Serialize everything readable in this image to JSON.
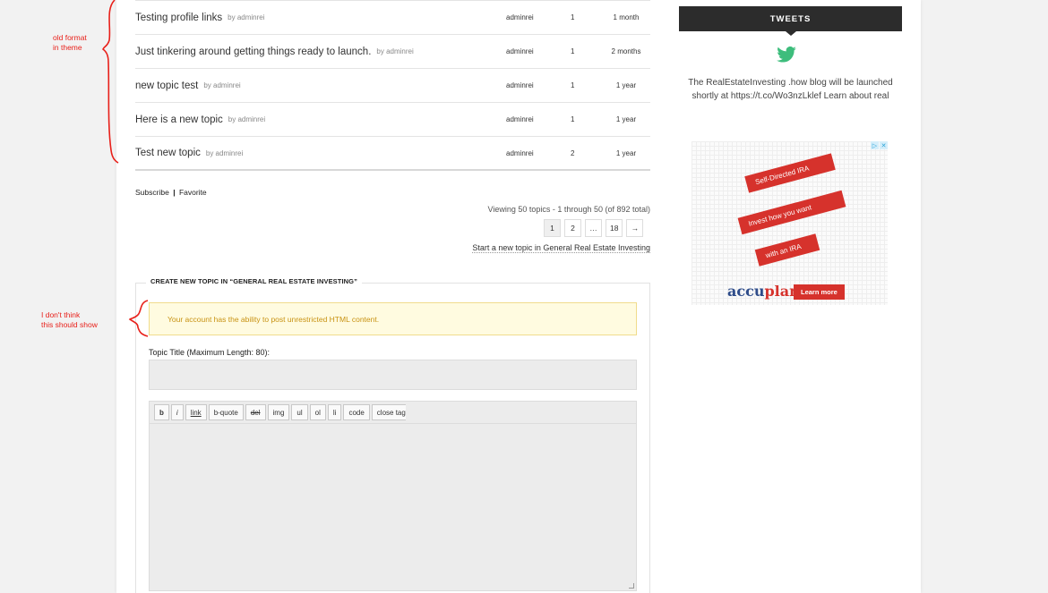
{
  "topics": [
    {
      "title": "Testing profile links",
      "by": "by adminrei",
      "author": "adminrei",
      "count": "1",
      "freshness": "1 month"
    },
    {
      "title": "Just tinkering around getting things ready to launch.",
      "by": "by adminrei",
      "author": "adminrei",
      "count": "1",
      "freshness": "2 months"
    },
    {
      "title": "new topic test",
      "by": "by adminrei",
      "author": "adminrei",
      "count": "1",
      "freshness": "1 year"
    },
    {
      "title": "Here is a new topic",
      "by": "by adminrei",
      "author": "adminrei",
      "count": "1",
      "freshness": "1 year"
    },
    {
      "title": "Test new topic",
      "by": "by adminrei",
      "author": "adminrei",
      "count": "2",
      "freshness": "1 year"
    }
  ],
  "forum_actions": {
    "subscribe": "Subscribe",
    "separator": "|",
    "favorite": "Favorite"
  },
  "pagination": {
    "viewing": "Viewing 50 topics - 1 through 50 (of 892 total)",
    "pages": [
      "1",
      "2",
      "…",
      "18",
      "→"
    ],
    "current": "1",
    "start_new": "Start a new topic in General Real Estate Investing"
  },
  "new_topic": {
    "legend": "CREATE NEW TOPIC IN “GENERAL REAL ESTATE INVESTING”",
    "notice": "Your account has the ability to post unrestricted HTML content.",
    "title_label": "Topic Title (Maximum Length: 80):",
    "title_value": "",
    "toolbar": [
      "b",
      "i",
      "link",
      "b-quote",
      "del",
      "img",
      "ul",
      "ol",
      "li",
      "code",
      "close tags"
    ]
  },
  "sidebar": {
    "tweets_heading": "TWEETS",
    "tweet": "The RealEstateInvesting .how blog will be launched shortly at https://t.co/Wo3nzLklef Learn about real",
    "ad": {
      "ribbon1": "Self-Directed IRA",
      "ribbon2": "Invest how you want",
      "ribbon3": "with an IRA",
      "brand_a": "accu",
      "brand_b": "plan",
      "cta": "Learn more"
    }
  },
  "annotations": {
    "note1_line1": "old format",
    "note1_line2": "in theme",
    "note2_line1": "I don't think",
    "note2_line2": "this should show"
  },
  "colors": {
    "annotation": "#e8201a",
    "twitter": "#3dbd7c",
    "notice_text": "#c89212",
    "ad_red": "#d6322c"
  }
}
